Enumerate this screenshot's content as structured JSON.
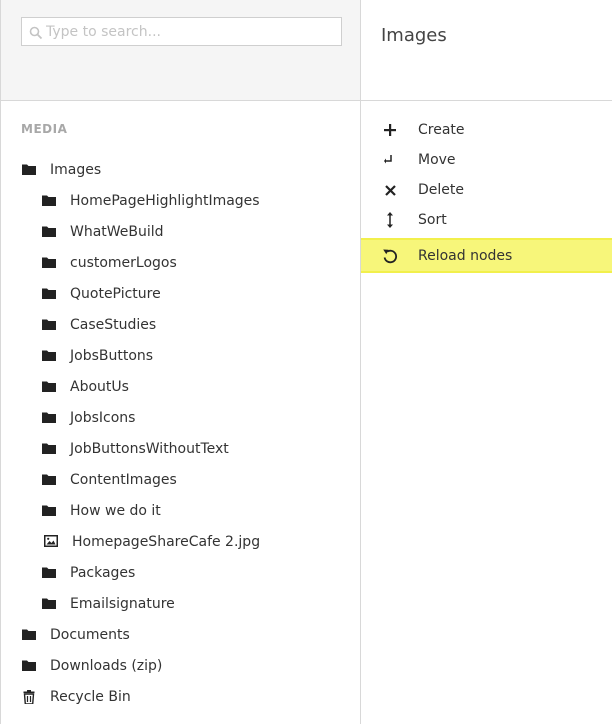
{
  "search": {
    "placeholder": "Type to search..."
  },
  "header": {
    "title": "Images"
  },
  "tree": {
    "section_label": "MEDIA",
    "root": {
      "label": "Images",
      "icon": "folder-icon"
    },
    "children": [
      {
        "label": "HomePageHighlightImages",
        "icon": "folder-icon"
      },
      {
        "label": "WhatWeBuild",
        "icon": "folder-icon"
      },
      {
        "label": "customerLogos",
        "icon": "folder-icon"
      },
      {
        "label": "QuotePicture",
        "icon": "folder-icon"
      },
      {
        "label": "CaseStudies",
        "icon": "folder-icon"
      },
      {
        "label": "JobsButtons",
        "icon": "folder-icon"
      },
      {
        "label": "AboutUs",
        "icon": "folder-icon"
      },
      {
        "label": "JobsIcons",
        "icon": "folder-icon"
      },
      {
        "label": "JobButtonsWithoutText",
        "icon": "folder-icon"
      },
      {
        "label": "ContentImages",
        "icon": "folder-icon"
      },
      {
        "label": "How we do it",
        "icon": "folder-icon"
      },
      {
        "label": "HomepageShareCafe 2.jpg",
        "icon": "image-icon"
      },
      {
        "label": "Packages",
        "icon": "folder-icon"
      },
      {
        "label": "Emailsignature",
        "icon": "folder-icon"
      }
    ],
    "bottom": [
      {
        "label": "Documents",
        "icon": "folder-icon"
      },
      {
        "label": "Downloads (zip)",
        "icon": "folder-icon"
      },
      {
        "label": "Recycle Bin",
        "icon": "trash-icon"
      }
    ]
  },
  "actions": [
    {
      "label": "Create",
      "icon": "plus-icon"
    },
    {
      "label": "Move",
      "icon": "move-arrow-icon"
    },
    {
      "label": "Delete",
      "icon": "close-icon"
    },
    {
      "label": "Sort",
      "icon": "sort-arrows-icon"
    },
    {
      "label": "Reload nodes",
      "icon": "reload-icon"
    }
  ],
  "colors": {
    "highlight": "#f7f67a",
    "highlight_border": "#f2f04c",
    "section_label": "#a8a8a8"
  }
}
